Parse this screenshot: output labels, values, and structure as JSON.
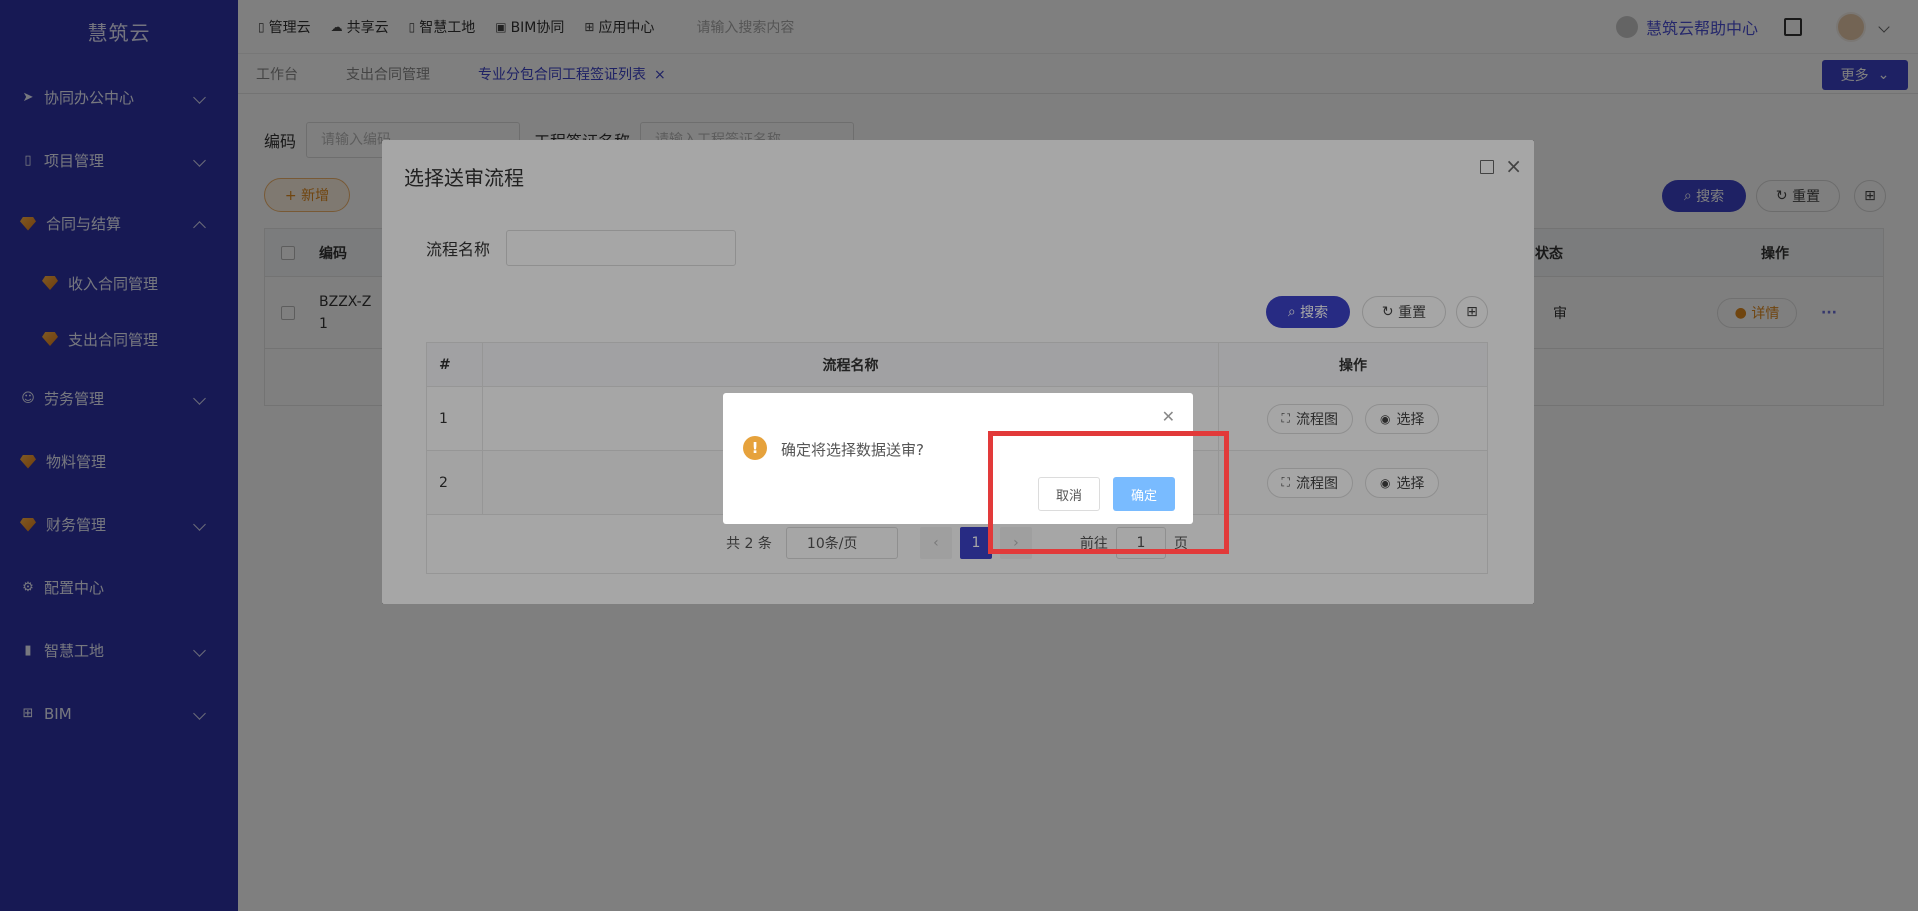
{
  "sidebar": {
    "brand": "慧筑云",
    "items": [
      {
        "label": "协同办公中心"
      },
      {
        "label": "项目管理"
      },
      {
        "label": "合同与结算"
      },
      {
        "label": "收入合同管理"
      },
      {
        "label": "支出合同管理"
      },
      {
        "label": "劳务管理"
      },
      {
        "label": "物料管理"
      },
      {
        "label": "财务管理"
      },
      {
        "label": "配置中心"
      },
      {
        "label": "智慧工地"
      },
      {
        "label": "BIM"
      }
    ]
  },
  "topbar": {
    "nav": [
      "管理云",
      "共享云",
      "智慧工地",
      "BIM协同",
      "应用中心"
    ],
    "search_placeholder": "请输入搜索内容",
    "help": "慧筑云帮助中心"
  },
  "tabs": {
    "items": [
      "工作台",
      "支出合同管理",
      "专业分包合同工程签证列表"
    ],
    "close": "×",
    "more": "更多"
  },
  "main": {
    "filter_code_label": "编码",
    "filter_code_placeholder": "请输入编码",
    "filter_name_label": "工程签证名称",
    "filter_name_placeholder": "请输入工程签证名称",
    "add_label": "+ 新增",
    "search_label": "搜索",
    "reset_label": "重置",
    "table_headers": {
      "code": "编码",
      "status": "状态",
      "ops": "操作"
    },
    "row": {
      "code_line1": "BZZX-Z",
      "code_line2": "1",
      "status": "审",
      "detail": "详情",
      "more": "···"
    }
  },
  "dialog": {
    "title": "选择送审流程",
    "filter_label": "流程名称",
    "search_label": "搜索",
    "reset_label": "重置",
    "headers": {
      "index": "#",
      "name": "流程名称",
      "ops": "操作"
    },
    "rows": [
      {
        "index": "1",
        "name": "",
        "flow_label": "流程图",
        "select_label": "选择"
      },
      {
        "index": "2",
        "name": "",
        "flow_label": "流程图",
        "select_label": "选择"
      }
    ],
    "pagination": {
      "total": "共 2 条",
      "page_size": "10条/页",
      "current_page": "1",
      "goto_label": "前往",
      "goto_value": "1",
      "page_suffix": "页"
    }
  },
  "confirm": {
    "message": "确定将选择数据送审?",
    "cancel_label": "取消",
    "ok_label": "确定"
  },
  "colors": {
    "sidebar_bg": "#2f32a8",
    "primary": "#3d42c9",
    "warning": "#e6a23c",
    "ok_button": "#79bbff",
    "highlight": "#e23a3a"
  }
}
